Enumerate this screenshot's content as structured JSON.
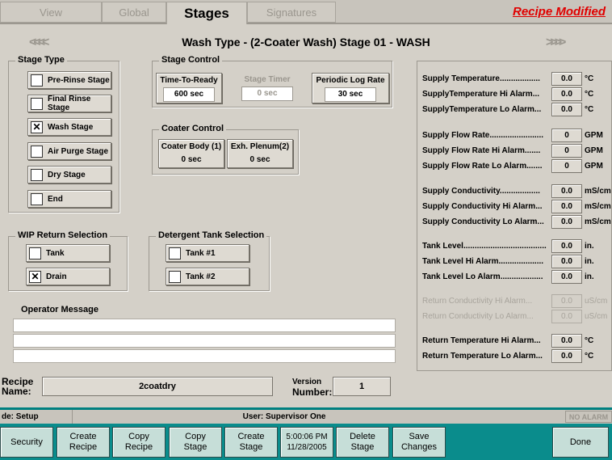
{
  "tabs": [
    "View",
    "Global",
    "Stages",
    "Signatures"
  ],
  "active_tab": "Stages",
  "recipe_modified": "Recipe Modified",
  "header": {
    "prev_arrow": "<<<<",
    "next_arrow": ">>>>",
    "title": "Wash Type - (2-Coater Wash)   Stage 01 - WASH"
  },
  "stage_type": {
    "legend": "Stage Type",
    "items": [
      {
        "label": "Pre-Rinse Stage",
        "checked": ""
      },
      {
        "label": "Final Rinse Stage",
        "checked": ""
      },
      {
        "label": "Wash Stage",
        "checked": "✕"
      },
      {
        "label": "Air Purge Stage",
        "checked": ""
      },
      {
        "label": "Dry Stage",
        "checked": ""
      },
      {
        "label": "End",
        "checked": ""
      }
    ]
  },
  "stage_control": {
    "legend": "Stage Control",
    "time_to_ready": {
      "label": "Time-To-Ready",
      "value": "600 sec"
    },
    "stage_timer": {
      "label": "Stage Timer",
      "value": "0 sec"
    },
    "periodic_log_rate": {
      "label": "Periodic Log Rate",
      "value": "30 sec"
    }
  },
  "coater_control": {
    "legend": "Coater Control",
    "coater_body": {
      "label": "Coater Body (1)",
      "value": "0 sec"
    },
    "exh_plenum": {
      "label": "Exh. Plenum(2)",
      "value": "0 sec"
    }
  },
  "wip_return": {
    "legend": "WIP Return Selection",
    "tank": {
      "label": "Tank",
      "checked": ""
    },
    "drain": {
      "label": "Drain",
      "checked": "✕"
    }
  },
  "detergent": {
    "legend": "Detergent Tank Selection",
    "tank1": {
      "label": "Tank #1",
      "checked": ""
    },
    "tank2": {
      "label": "Tank #2",
      "checked": ""
    }
  },
  "operator_message": {
    "label": "Operator Message"
  },
  "params": [
    {
      "label": "Supply Temperature..................",
      "value": "0.0",
      "unit": "°C"
    },
    {
      "label": "SupplyTemperature Hi Alarm...",
      "value": "0.0",
      "unit": "°C"
    },
    {
      "label": "SupplyTemperature Lo Alarm...",
      "value": "0.0",
      "unit": "°C"
    },
    {
      "label": "Supply Flow Rate........................",
      "value": "0",
      "unit": "GPM"
    },
    {
      "label": "Supply Flow Rate Hi Alarm.......",
      "value": "0",
      "unit": "GPM"
    },
    {
      "label": "Supply Flow Rate Lo Alarm.......",
      "value": "0",
      "unit": "GPM"
    },
    {
      "label": "Supply Conductivity..................",
      "value": "0.0",
      "unit": "mS/cm"
    },
    {
      "label": "Supply Conductivity Hi Alarm...",
      "value": "0.0",
      "unit": "mS/cm"
    },
    {
      "label": "Supply Conductivity Lo Alarm...",
      "value": "0.0",
      "unit": "mS/cm"
    },
    {
      "label": "Tank Level..........................................",
      "value": "0.0",
      "unit": "in."
    },
    {
      "label": "Tank Level Hi Alarm....................",
      "value": "0.0",
      "unit": "in."
    },
    {
      "label": "Tank Level Lo Alarm...................",
      "value": "0.0",
      "unit": "in."
    },
    {
      "label": "Return Conductivity Hi Alarm...",
      "value": "0.0",
      "unit": "uS/cm"
    },
    {
      "label": "Return Conductivity Lo Alarm...",
      "value": "0.0",
      "unit": "uS/cm"
    },
    {
      "label": "Return Temperature Hi Alarm...",
      "value": "0.0",
      "unit": "°C"
    },
    {
      "label": "Return Temperature Lo Alarm...",
      "value": "0.0",
      "unit": "°C"
    }
  ],
  "recipe": {
    "name_label_1": "Recipe",
    "name_label_2": "Name:",
    "name_value": "2coatdry",
    "version_label_1": "Version",
    "version_label_2": "Number:",
    "version_value": "1"
  },
  "status": {
    "mode": "de: Setup",
    "user": "User: Supervisor One",
    "alarm": "NO ALARM"
  },
  "bottom_buttons": {
    "security": "Security",
    "create_recipe": "Create\nRecipe",
    "copy_recipe": "Copy\nRecipe",
    "copy_stage": "Copy\nStage",
    "create_stage": "Create\nStage",
    "clock": "5:00:06 PM\n11/28/2005",
    "delete_stage": "Delete\nStage",
    "save_changes": "Save\nChanges",
    "done": "Done"
  }
}
